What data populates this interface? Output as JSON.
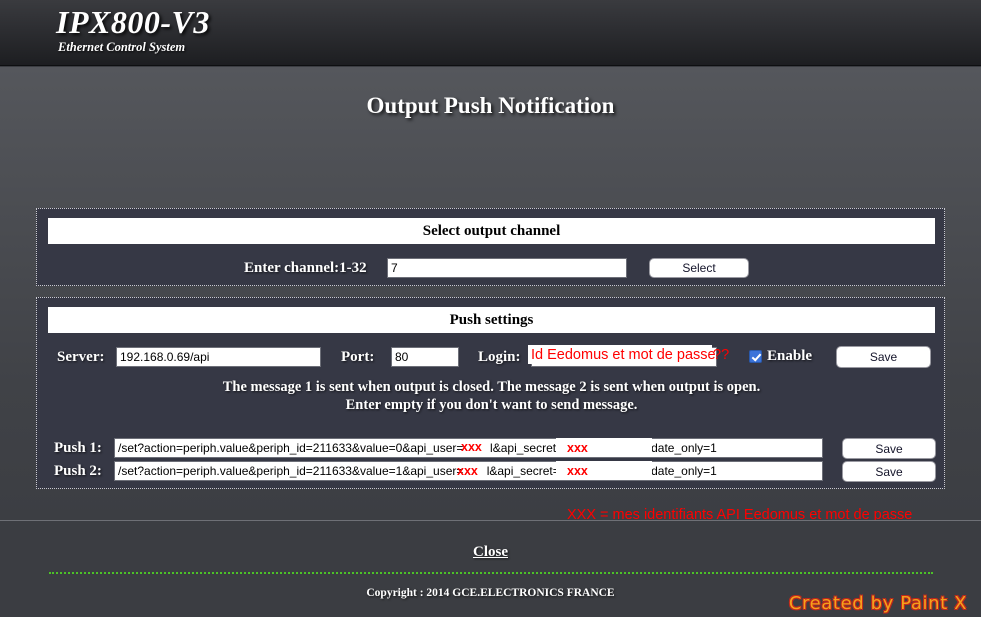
{
  "header": {
    "brand": "IPX800-V3",
    "subtitle": "Ethernet Control System"
  },
  "page_title": "Output Push Notification",
  "channel_panel": {
    "legend": "Select output channel",
    "channel_label": "Enter channel:1-32",
    "channel_value": "7",
    "select_button": "Select"
  },
  "push_panel": {
    "legend": "Push settings",
    "server_label": "Server:",
    "server_value": "192.168.0.69/api",
    "port_label": "Port:",
    "port_value": "80",
    "login_label": "Login:",
    "login_value": "",
    "enable_label": "Enable",
    "enable_checked": true,
    "save_button": "Save",
    "hint_line1": "The message 1 is sent when output is closed. The message 2 is sent when output is open.",
    "hint_line2": "Enter empty if you don't want to send message.",
    "push1_label": "Push 1:",
    "push1_value": "/set?action=periph.value&periph_id=211633&value=0&api_user=        l&api_secret=                    &update_only=1",
    "push1_save": "Save",
    "push2_label": "Push 2:",
    "push2_value": "/set?action=periph.value&periph_id=211633&value=1&api_user=       l&api_secret=                    t&update_only=1",
    "push2_save": "Save"
  },
  "annotations": {
    "login_overlay": "Id Eedomus et mot de passe",
    "login_question": "??",
    "push1_user": "xxx",
    "push1_secret": "xxx",
    "push2_user": "xxx",
    "push2_secret": "xxx",
    "legend_note": "XXX = mes identifiants API Eedomus et mot de passe",
    "color": "#ff0000"
  },
  "footer": {
    "close_label": "Close",
    "copyright": "Copyright : 2014 GCE.ELECTRONICS FRANCE",
    "watermark": "Created by Paint X",
    "watermark_color": "#f5a11b",
    "rule_color": "#4cc128"
  }
}
